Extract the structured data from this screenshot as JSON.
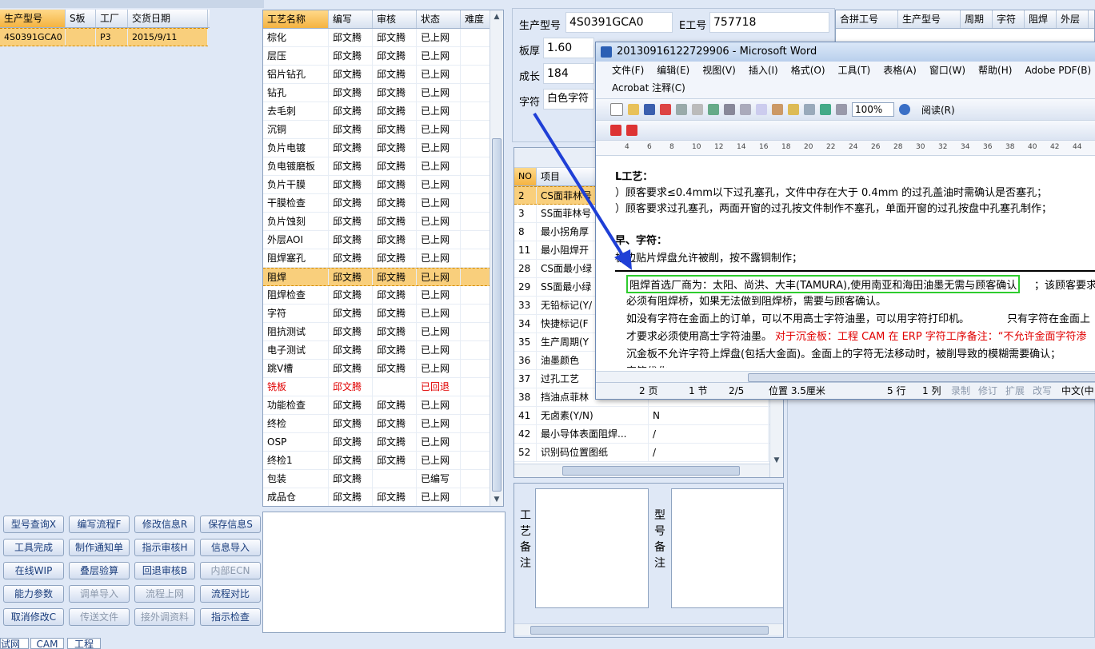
{
  "left_table": {
    "headers": [
      "生产型号",
      "S板",
      "工厂",
      "交货日期"
    ],
    "rows": [
      [
        "4S0391GCA0",
        "",
        "P3",
        "2015/9/11"
      ]
    ]
  },
  "process_table": {
    "headers": [
      "工艺名称",
      "编写",
      "审核",
      "状态",
      "难度"
    ],
    "rows": [
      [
        "棕化",
        "邱文腾",
        "邱文腾",
        "已上网"
      ],
      [
        "层压",
        "邱文腾",
        "邱文腾",
        "已上网"
      ],
      [
        "铝片钻孔",
        "邱文腾",
        "邱文腾",
        "已上网"
      ],
      [
        "钻孔",
        "邱文腾",
        "邱文腾",
        "已上网"
      ],
      [
        "去毛刺",
        "邱文腾",
        "邱文腾",
        "已上网"
      ],
      [
        "沉铜",
        "邱文腾",
        "邱文腾",
        "已上网"
      ],
      [
        "负片电镀",
        "邱文腾",
        "邱文腾",
        "已上网"
      ],
      [
        "负电镀磨板",
        "邱文腾",
        "邱文腾",
        "已上网"
      ],
      [
        "负片干膜",
        "邱文腾",
        "邱文腾",
        "已上网"
      ],
      [
        "干膜检查",
        "邱文腾",
        "邱文腾",
        "已上网"
      ],
      [
        "负片蚀刻",
        "邱文腾",
        "邱文腾",
        "已上网"
      ],
      [
        "外层AOI",
        "邱文腾",
        "邱文腾",
        "已上网"
      ],
      [
        "阻焊塞孔",
        "邱文腾",
        "邱文腾",
        "已上网"
      ],
      [
        "阻焊",
        "邱文腾",
        "邱文腾",
        "已上网"
      ],
      [
        "阻焊检查",
        "邱文腾",
        "邱文腾",
        "已上网"
      ],
      [
        "字符",
        "邱文腾",
        "邱文腾",
        "已上网"
      ],
      [
        "阻抗测试",
        "邱文腾",
        "邱文腾",
        "已上网"
      ],
      [
        "电子测试",
        "邱文腾",
        "邱文腾",
        "已上网"
      ],
      [
        "跳V槽",
        "邱文腾",
        "邱文腾",
        "已上网"
      ],
      [
        "铣板",
        "邱文腾",
        "",
        "已回退"
      ],
      [
        "功能检查",
        "邱文腾",
        "邱文腾",
        "已上网"
      ],
      [
        "终检",
        "邱文腾",
        "邱文腾",
        "已上网"
      ],
      [
        "OSP",
        "邱文腾",
        "邱文腾",
        "已上网"
      ],
      [
        "终检1",
        "邱文腾",
        "邱文腾",
        "已上网"
      ],
      [
        "包装",
        "邱文腾",
        "",
        "已编写"
      ],
      [
        "成品仓",
        "邱文腾",
        "邱文腾",
        "已上网"
      ]
    ]
  },
  "buttons": [
    [
      "型号查询X",
      "编写流程F",
      "修改信息R",
      "保存信息S"
    ],
    [
      "工具完成",
      "制作通知单",
      "指示审核H",
      "信息导入"
    ],
    [
      "在线WIP",
      "叠层验算",
      "回退审核B",
      "内部ECN"
    ],
    [
      "能力参数",
      "调单导入",
      "流程上网",
      "流程对比"
    ],
    [
      "取消修改C",
      "传送文件",
      "接外调资料",
      "指示检查"
    ]
  ],
  "form": {
    "model_label": "生产型号",
    "model_value": "4S0391GCA0",
    "eno_label": "E工号",
    "eno_value": "757718",
    "thick_label": "板厚",
    "thick_value": "1.60",
    "length_label": "成长",
    "length_value": "184",
    "char_label": "字符",
    "char_value": "白色字符"
  },
  "right_table": {
    "headers": [
      "合拼工号",
      "生产型号",
      "周期",
      "字符",
      "阻焊",
      "外层"
    ]
  },
  "item_table": {
    "headers": [
      "NO",
      "项目"
    ],
    "rows": [
      [
        "2",
        "CS面菲林号"
      ],
      [
        "3",
        "SS面菲林号"
      ],
      [
        "8",
        "最小拐角厚"
      ],
      [
        "11",
        "最小阻焊开"
      ],
      [
        "28",
        "CS面最小绿"
      ],
      [
        "29",
        "SS面最小绿"
      ],
      [
        "33",
        "无铅标记(Y/"
      ],
      [
        "34",
        "快捷标记(F"
      ],
      [
        "35",
        "生产周期(Y"
      ],
      [
        "36",
        "油墨颜色"
      ],
      [
        "37",
        "过孔工艺"
      ],
      [
        "38",
        "挡油点菲林"
      ],
      [
        "41",
        "无卤素(Y/N)"
      ],
      [
        "42",
        "最小导体表面阻焊..."
      ],
      [
        "52",
        "识别码位置图纸"
      ]
    ],
    "values": [
      "",
      "",
      "",
      "",
      "",
      "",
      "",
      "",
      "",
      "",
      "",
      "",
      "N",
      "/",
      "/"
    ]
  },
  "notes": {
    "process_note_label": "工艺备注",
    "model_note_label": "型号备注"
  },
  "bottom_tabs": [
    "试网",
    "CAM",
    "工程"
  ],
  "word": {
    "title": "20130916122729906 - Microsoft Word",
    "menu": [
      "文件(F)",
      "编辑(E)",
      "视图(V)",
      "插入(I)",
      "格式(O)",
      "工具(T)",
      "表格(A)",
      "窗口(W)",
      "帮助(H)",
      "Adobe PDF(B)",
      "Acrobat 注释(C)"
    ],
    "zoom": "100%",
    "read_btn": "阅读(R)",
    "ruler": [
      "4",
      "6",
      "8",
      "10",
      "12",
      "14",
      "16",
      "18",
      "20",
      "22",
      "24",
      "26",
      "28",
      "30",
      "32",
      "34",
      "36",
      "38",
      "40",
      "42",
      "44"
    ],
    "lines": {
      "l1": "L工艺：",
      "l2": "）顾客要求≤0.4mm以下过孔塞孔，文件中存在大于 0.4mm 的过孔盖油时需确认是否塞孔；",
      "l3": "）顾客要求过孔塞孔，两面开窗的过孔按文件制作不塞孔，单面开窗的过孔按盘中孔塞孔制作；",
      "l4": "早、字符：",
      "l5": "板边贴片焊盘允许被削，按不露铜制作；",
      "l6a": "阻焊首选厂商为：太阳、尚洪、大丰(TAMURA),使用南亚和海田油墨无需与顾客确认",
      "l6b": "；该顾客要求",
      "l7": "必须有阻焊桥，如果无法做到阻焊桥，需要与顾客确认。",
      "l8a": "如没有字符在金面上的订单，可以不用高士字符油墨，可以用字符打印机。",
      "l8b": "只有字符在金面上",
      "l9a": "才要求必须使用高士字符油墨。",
      "l9b": "对于沉金板：工程 CAM 在 ERP 字符工序备注：“不允许金面字符渗",
      "l10": "沉金板不允许字符上焊盘(包括大金面)。金面上的字符无法移动时，被削导致的模糊需要确认；",
      "l11": "字符优化。"
    },
    "status": {
      "page": "2 页",
      "section": "1 节",
      "pages": "2/5",
      "pos": "位置 3.5厘米",
      "line": "5 行",
      "col": "1 列",
      "rec": "录制",
      "rev": "修订",
      "ext": "扩展",
      "ovr": "改写",
      "lang": "中文(中"
    }
  },
  "colors": {
    "highlight_box": "#2ecc2e",
    "arrow": "#1f3fd6",
    "red_text": "#e00000",
    "selected_row": "#f9cf7c"
  }
}
